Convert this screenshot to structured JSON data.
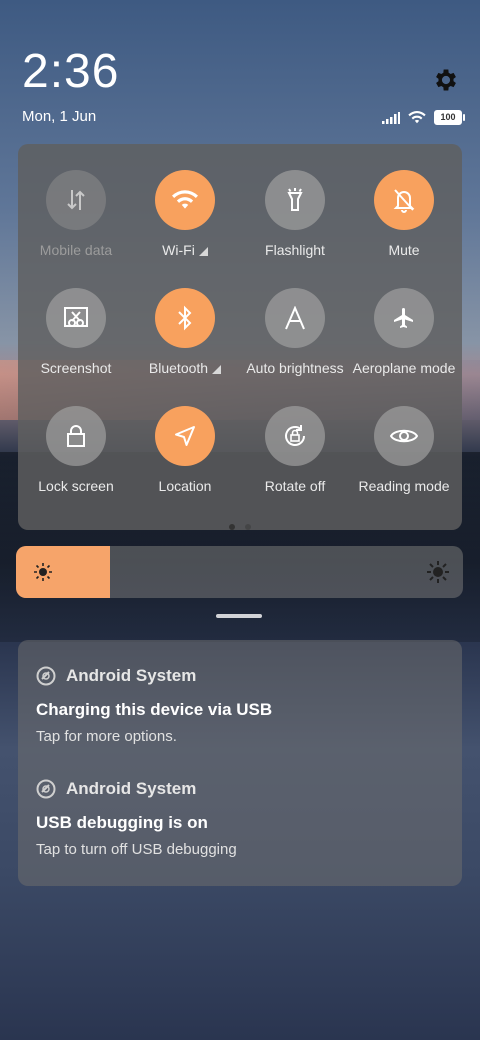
{
  "header": {
    "time": "2:36",
    "date": "Mon, 1 Jun",
    "battery_level": "100",
    "icons": [
      "signal-icon",
      "wifi-icon",
      "battery-icon",
      "gear-icon"
    ]
  },
  "quick_settings": {
    "tiles": [
      {
        "label": "Mobile data",
        "icon": "mobile-data-icon",
        "state": "disabled"
      },
      {
        "label": "Wi-Fi",
        "icon": "wifi-icon",
        "state": "on"
      },
      {
        "label": "Flashlight",
        "icon": "flashlight-icon",
        "state": "off"
      },
      {
        "label": "Mute",
        "icon": "bell-off-icon",
        "state": "on"
      },
      {
        "label": "Screenshot",
        "icon": "screenshot-icon",
        "state": "off"
      },
      {
        "label": "Bluetooth",
        "icon": "bluetooth-icon",
        "state": "on"
      },
      {
        "label": "Auto brightness",
        "icon": "auto-brightness-icon",
        "state": "off"
      },
      {
        "label": "Aeroplane mode",
        "icon": "airplane-icon",
        "state": "off"
      },
      {
        "label": "Lock screen",
        "icon": "lock-icon",
        "state": "off"
      },
      {
        "label": "Location",
        "icon": "location-icon",
        "state": "on"
      },
      {
        "label": "Rotate off",
        "icon": "rotate-lock-icon",
        "state": "off"
      },
      {
        "label": "Reading mode",
        "icon": "eye-icon",
        "state": "off"
      }
    ],
    "page_count": 2,
    "current_page": 1
  },
  "brightness": {
    "level": 0.21
  },
  "notifications": [
    {
      "app": "Android System",
      "title": "Charging this device via USB",
      "text": "Tap for more options."
    },
    {
      "app": "Android System",
      "title": "USB debugging is on",
      "text": "Tap to turn off USB debugging"
    }
  ],
  "colors": {
    "accent": "#f8a15e",
    "tile_off": "#a0a0a0",
    "panel": "#5f5f5f"
  }
}
